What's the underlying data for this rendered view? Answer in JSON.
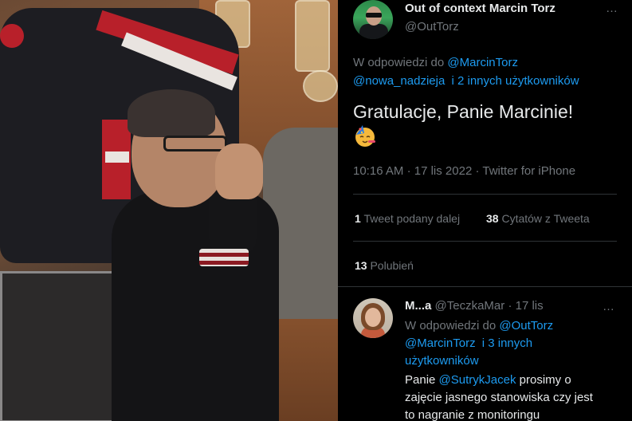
{
  "tweet": {
    "author_name": "Out of context Marcin Torz",
    "author_handle": "@OutTorz",
    "more_icon": "…",
    "reply_prefix": "W odpowiedzi do",
    "reply_to_1": "@MarcinTorz",
    "reply_to_2": "@nowa_nadzieja",
    "reply_to_others": "i 2 innych użytkowników",
    "text": "Gratulacje, Panie Marcinie!",
    "emoji": "partying-face",
    "time": "10:16 AM",
    "date": "17 lis 2022",
    "source": "Twitter for iPhone",
    "meta_sep": "·",
    "retweets_count": "1",
    "retweets_label": "Tweet podany dalej",
    "quotes_count": "38",
    "quotes_label": "Cytatów z Tweeta",
    "likes_count": "13",
    "likes_label": "Polubień"
  },
  "reply": {
    "author_name": "M...a",
    "author_handle": "@TeczkaMar",
    "sep": "·",
    "date": "17 lis",
    "more_icon": "…",
    "reply_prefix": "W odpowiedzi do",
    "reply_to_1": "@OutTorz",
    "reply_to_2": "@MarcinTorz",
    "reply_to_others_1": "i 3 innych",
    "reply_to_others_2": "użytkowników",
    "body_prefix": "Panie",
    "body_mention": "@SutrykJacek",
    "body_rest": "prosimy o",
    "body_line_2": "zajęcie jasnego stanowiska czy jest",
    "body_line_3": "to nagranie z monitoringu"
  },
  "colors": {
    "background": "#000000",
    "text_primary": "#e7e9ea",
    "text_secondary": "#71767b",
    "link": "#1d9bf0",
    "divider": "#2f3336"
  }
}
